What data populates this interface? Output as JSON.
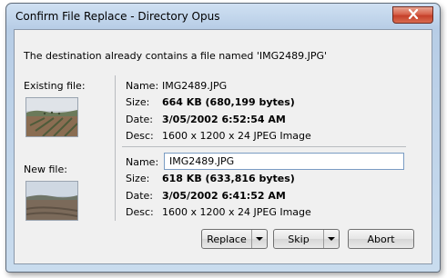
{
  "window": {
    "title": "Confirm File Replace - Directory Opus"
  },
  "dialog": {
    "message": "The destination already contains a file named 'IMG2489.JPG'",
    "labels": {
      "name": "Name:",
      "size": "Size:",
      "date": "Date:",
      "desc": "Desc:"
    },
    "existing": {
      "heading": "Existing file:",
      "name": "IMG2489.JPG",
      "size": "664 KB (680,199 bytes)",
      "date": "3/05/2002 6:52:54 AM",
      "desc": "1600 x 1200 x 24 JPEG Image"
    },
    "new": {
      "heading": "New file:",
      "name": "IMG2489.JPG",
      "size": "618 KB (633,816 bytes)",
      "date": "3/05/2002 6:41:52 AM",
      "desc": "1600 x 1200 x 24 JPEG Image"
    }
  },
  "buttons": {
    "replace": "Replace",
    "skip": "Skip",
    "abort": "Abort"
  },
  "icons": {
    "close": "close-icon",
    "dropdown": "chevron-down-icon"
  }
}
